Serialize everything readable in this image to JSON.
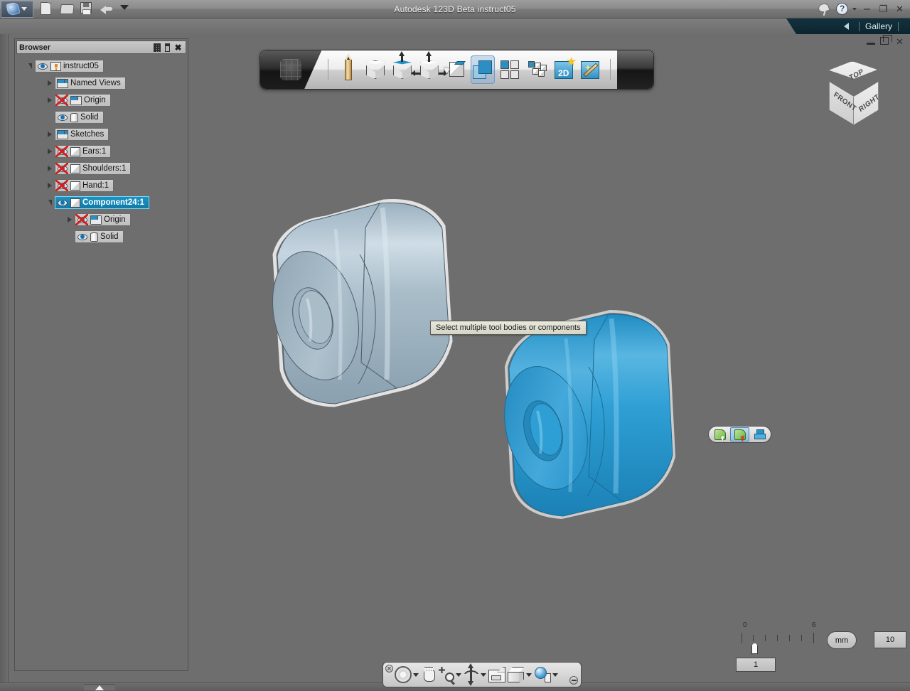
{
  "titlebar": {
    "app_name": "Autodesk 123D Beta",
    "document_name": "instruct05",
    "title_full": "Autodesk 123D Beta    instruct05",
    "quick_access": [
      {
        "name": "app-menu-button",
        "label": "123D"
      },
      {
        "name": "new-button",
        "label": "New"
      },
      {
        "name": "open-button",
        "label": "Open"
      },
      {
        "name": "save-button",
        "label": "Save"
      },
      {
        "name": "undo-button",
        "label": "Undo"
      },
      {
        "name": "more-commands-button",
        "label": "More"
      }
    ],
    "right_items": [
      {
        "name": "connect-icon",
        "label": "Connect"
      },
      {
        "name": "help-icon",
        "label": "Help"
      }
    ],
    "window_buttons": {
      "minimize": "–",
      "maximize": "❐",
      "close": "✕"
    }
  },
  "gallerybar": {
    "back_arrow": "◀",
    "label": "Gallery"
  },
  "document_window_buttons": {
    "minimize": "–",
    "restore": "❐",
    "close": "✕"
  },
  "browser": {
    "title": "Browser",
    "header_buttons": [
      {
        "name": "browser-grid-button",
        "label": "Layout"
      },
      {
        "name": "browser-dock-button",
        "label": "Dock"
      },
      {
        "name": "browser-close-button",
        "label": "✕"
      }
    ],
    "tree": [
      {
        "label": "instruct05",
        "indent": 0,
        "expander": "down",
        "icons": [
          "eye",
          "pin"
        ],
        "selected": false
      },
      {
        "label": "Named Views",
        "indent": 1,
        "expander": "right",
        "icons": [
          "folder-blue"
        ],
        "selected": false
      },
      {
        "label": "Origin",
        "indent": 1,
        "expander": "right",
        "icons": [
          "eye-off",
          "folder"
        ],
        "selected": false
      },
      {
        "label": "Solid",
        "indent": 1,
        "expander": "none",
        "icons": [
          "eye",
          "cylinder"
        ],
        "selected": false
      },
      {
        "label": "Sketches",
        "indent": 1,
        "expander": "right",
        "icons": [
          "folder-blue"
        ],
        "selected": false
      },
      {
        "label": "Ears:1",
        "indent": 1,
        "expander": "right",
        "icons": [
          "eye-off",
          "cube"
        ],
        "selected": false
      },
      {
        "label": "Shoulders:1",
        "indent": 1,
        "expander": "right",
        "icons": [
          "eye-off",
          "cube"
        ],
        "selected": false
      },
      {
        "label": "Hand:1",
        "indent": 1,
        "expander": "right",
        "icons": [
          "eye-off",
          "cube"
        ],
        "selected": false
      },
      {
        "label": "Component24:1",
        "indent": 1,
        "expander": "down",
        "icons": [
          "eye",
          "cube"
        ],
        "selected": true
      },
      {
        "label": "Origin",
        "indent": 2,
        "expander": "right",
        "icons": [
          "eye-off",
          "folder"
        ],
        "selected": false
      },
      {
        "label": "Solid",
        "indent": 2,
        "expander": "none",
        "icons": [
          "eye",
          "cylinder"
        ],
        "selected": false
      }
    ]
  },
  "toolbar": {
    "logo_name": "cube-grid-logo",
    "items": [
      {
        "name": "sketch-tool",
        "label": "Sketch",
        "active": false
      },
      {
        "name": "primitives-tool",
        "label": "Primitives",
        "active": false
      },
      {
        "name": "construct-tool",
        "label": "Construct",
        "active": false
      },
      {
        "name": "modify-tool",
        "label": "Modify",
        "active": false
      },
      {
        "name": "bevel-tool",
        "label": "Bevel",
        "active": false
      },
      {
        "name": "combine-tool",
        "label": "Combine",
        "active": true
      },
      {
        "name": "pattern-tool",
        "label": "Pattern",
        "active": false
      },
      {
        "name": "assemble-tool",
        "label": "Assemble",
        "active": false
      },
      {
        "name": "drawing-2d-tool",
        "label": "2D Drawing",
        "active": false
      },
      {
        "name": "smart-tool",
        "label": "Smart Tool",
        "active": false
      }
    ]
  },
  "viewcube": {
    "faces": {
      "top": "TOP",
      "front": "FRONT",
      "right": "RIGHT"
    }
  },
  "canvas": {
    "background_color": "#6e6e6e",
    "tooltip": "Select multiple tool bodies or components",
    "models": [
      {
        "name": "target-body",
        "color": "#a9bdc9",
        "state": "highlighted",
        "outline_color": "#e8e8e8"
      },
      {
        "name": "tool-body",
        "color": "#2e9fd4",
        "state": "selected",
        "outline_color": "#d8d8d8"
      }
    ]
  },
  "minibar": {
    "buttons": [
      {
        "name": "select-target-body-button",
        "label": "Target body",
        "selected": false
      },
      {
        "name": "select-tool-bodies-button",
        "label": "Tool bodies",
        "selected": true
      },
      {
        "name": "combine-operation-button",
        "label": "Operation",
        "selected": false
      }
    ]
  },
  "scale": {
    "tick_labels": [
      "0",
      "6"
    ],
    "value": "1",
    "unit": "mm",
    "max": "10"
  },
  "navbar": {
    "close_label": "✕",
    "items": [
      {
        "name": "steering-wheel-tool",
        "label": "SteeringWheels",
        "has_caret": true
      },
      {
        "name": "pan-tool",
        "label": "Pan",
        "has_caret": false
      },
      {
        "name": "zoom-tool",
        "label": "Zoom",
        "has_caret": true
      },
      {
        "name": "orbit-tool",
        "label": "Orbit",
        "has_caret": true
      },
      {
        "name": "fit-view-tool",
        "label": "Fit",
        "has_caret": false
      },
      {
        "name": "display-style-tool",
        "label": "Display Style",
        "has_caret": true
      },
      {
        "name": "visual-style-tool",
        "label": "Visual Style",
        "has_caret": true
      }
    ]
  }
}
